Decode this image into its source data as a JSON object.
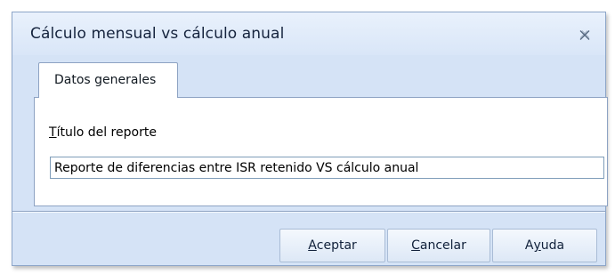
{
  "window": {
    "title": "Cálculo mensual vs cálculo anual",
    "close_icon": "close-icon"
  },
  "tabs": [
    {
      "label": "Datos generales",
      "selected": true
    }
  ],
  "form": {
    "title_label_hotkey": "T",
    "title_label_rest": "ítulo del reporte",
    "title_value": "Reporte de diferencias entre ISR retenido VS cálculo anual"
  },
  "buttons": {
    "accept_hotkey": "A",
    "accept_rest": "ceptar",
    "cancel_hotkey": "C",
    "cancel_rest": "ancelar",
    "help_pre": "A",
    "help_hotkey": "y",
    "help_post": "uda"
  },
  "colors": {
    "dialog_background": "#d5e3f6",
    "border": "#8ea3c3",
    "title_text": "#15233d"
  }
}
